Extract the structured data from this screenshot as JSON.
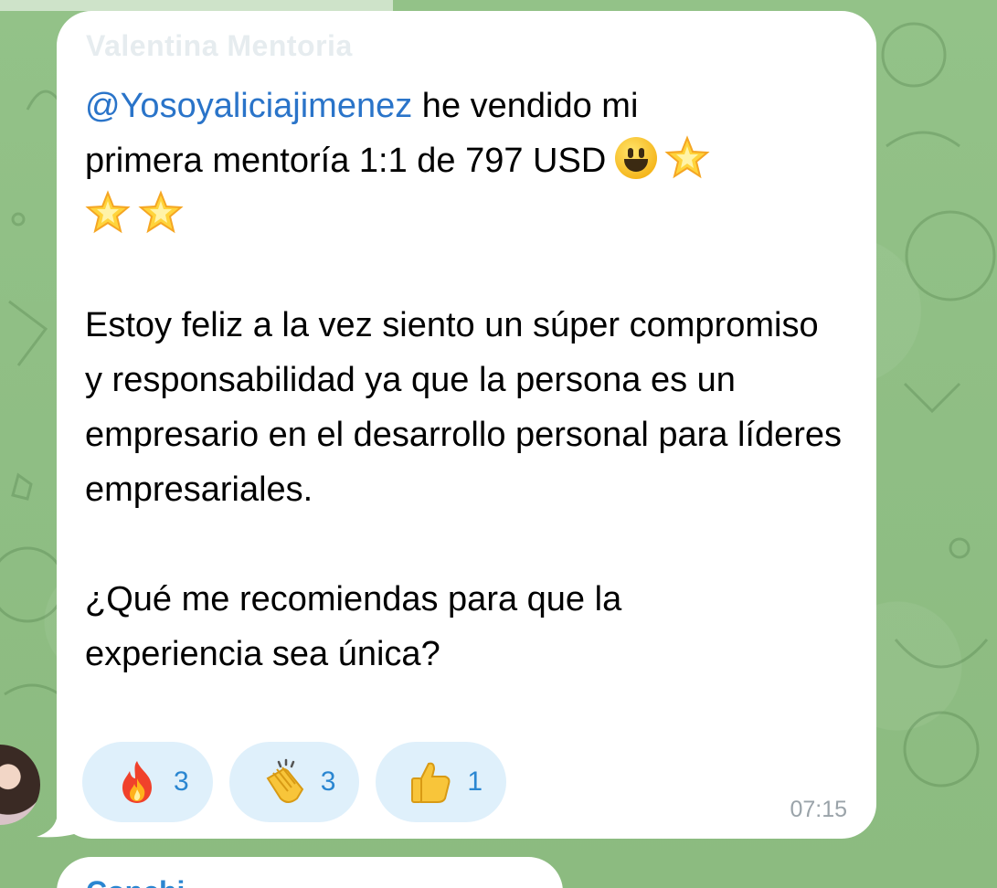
{
  "colors": {
    "chat_background": "#8fbf82",
    "bubble": "#ffffff",
    "mention": "#2a74c9",
    "reaction_bg": "#dff0fb",
    "reaction_count": "#2a86d1",
    "timestamp": "#9aa3a9"
  },
  "message": {
    "sender": "Valentina Mentoria",
    "mention": "@Yosoyaliciajimenez",
    "line1_rest": " he vendido mi",
    "line2": "primera mentoría 1:1 de 797 USD",
    "emojis_after": [
      "smiley-icon",
      "glowing-star-icon",
      "glowing-star-icon",
      "glowing-star-icon"
    ],
    "paragraph2": "Estoy feliz a la vez siento un súper compromiso y responsabilidad ya que la persona es un empresario en el desarrollo personal para líderes empresariales.",
    "paragraph3": "¿Qué me recomiendas para que la experiencia sea única?",
    "time": "07:15"
  },
  "reactions": [
    {
      "icon": "fire-icon",
      "count": "3"
    },
    {
      "icon": "clapping-hands-icon",
      "count": "3"
    },
    {
      "icon": "thumbs-up-icon",
      "count": "1"
    }
  ],
  "next_message": {
    "sender": "Conchi"
  }
}
